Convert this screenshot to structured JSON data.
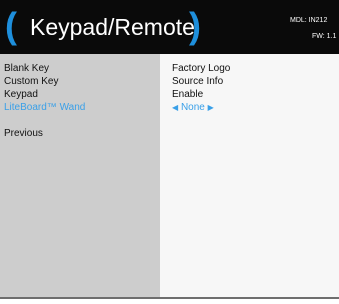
{
  "header": {
    "paren_left": "(",
    "title": "Keypad/Remote",
    "paren_right": ")",
    "model": "MDL: IN212",
    "firmware": "FW: 1.1"
  },
  "menu": {
    "items": [
      {
        "label": "Blank Key",
        "value": "Factory Logo",
        "selected": false
      },
      {
        "label": "Custom Key",
        "value": "Source Info",
        "selected": false
      },
      {
        "label": "Keypad",
        "value": "Enable",
        "selected": false
      },
      {
        "label": "LiteBoard™ Wand",
        "value": "None",
        "selected": true
      }
    ],
    "previous_label": "Previous",
    "arrow_left": "◀",
    "arrow_right": "▶"
  },
  "colors": {
    "accent": "#1e8fdc",
    "selected_text": "#3aa0e8",
    "header_bg": "#0a0a0a",
    "left_panel_bg": "#cdcdcd",
    "right_panel_bg": "#f7f7f7"
  }
}
